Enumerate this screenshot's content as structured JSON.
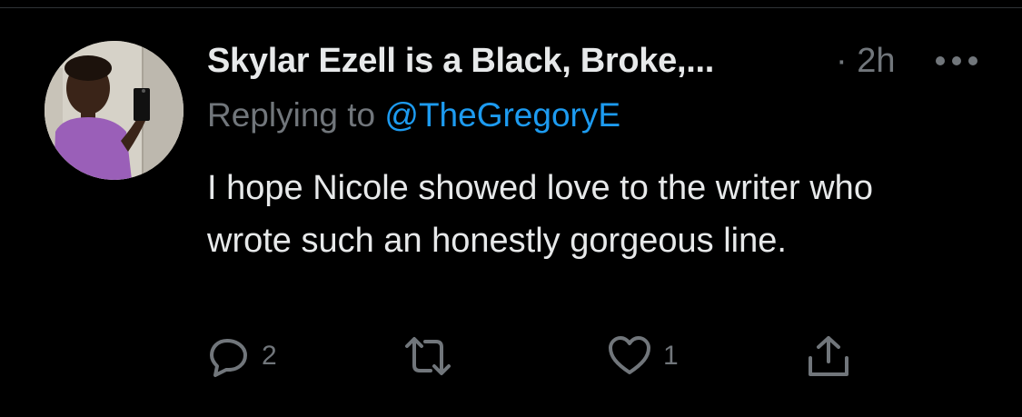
{
  "tweet": {
    "author_name": "Skylar Ezell is a Black, Broke,...",
    "timestamp": "· 2h",
    "replying_prefix": "Replying to",
    "replying_handle": "@TheGregoryE",
    "text": "I hope Nicole showed love to the writer who wrote such an honestly gorgeous line."
  },
  "actions": {
    "reply_count": "2",
    "retweet_count": "",
    "like_count": "1"
  },
  "icons": {
    "more": "more-icon",
    "reply": "reply-icon",
    "retweet": "retweet-icon",
    "like": "heart-icon",
    "share": "share-icon"
  },
  "colors": {
    "background": "#000000",
    "text_primary": "#e7e9ea",
    "text_secondary": "#71767b",
    "link": "#1d9bf0"
  }
}
